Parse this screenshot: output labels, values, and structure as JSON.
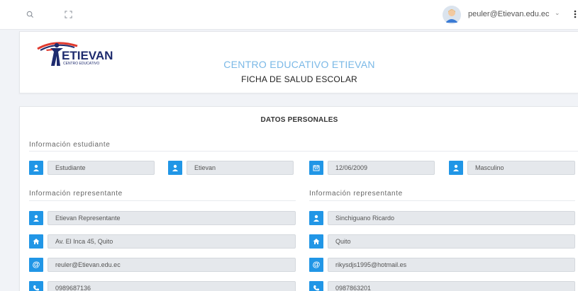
{
  "topbar": {
    "user_email": "peuler@Etievan.edu.ec"
  },
  "header": {
    "logo_text": "ETIEVAN",
    "logo_subtext": "CENTRO EDUCATIVO",
    "school_name": "CENTRO EDUCATIVO ETIEVAN",
    "form_title": "FICHA DE SALUD ESCOLAR"
  },
  "main": {
    "section_title": "DATOS PERSONALES",
    "student": {
      "label": "Información estudiante",
      "first_name": "Estudiante",
      "last_name": "Etievan",
      "birth_date": "12/06/2009",
      "gender": "Masculino"
    },
    "rep1": {
      "label": "Información representante",
      "name": "Etievan Representante",
      "address": "Av. El Inca 45, Quito",
      "email": "reuler@Etievan.edu.ec",
      "phone": "0989687136"
    },
    "rep2": {
      "label": "Información representante",
      "name": "Sinchiguano Ricardo",
      "address": "Quito",
      "email": "rikysdjs1995@hotmail.es",
      "phone": "0987863201"
    }
  },
  "colors": {
    "accent": "#2196e6",
    "title_blue": "#7ab8e6",
    "logo_red": "#e03a2f",
    "logo_navy": "#1e2b6e"
  },
  "icons": [
    "search-icon",
    "expand-icon",
    "user-icon",
    "calendar-icon",
    "home-icon",
    "at-icon",
    "phone-icon",
    "more-icon"
  ]
}
